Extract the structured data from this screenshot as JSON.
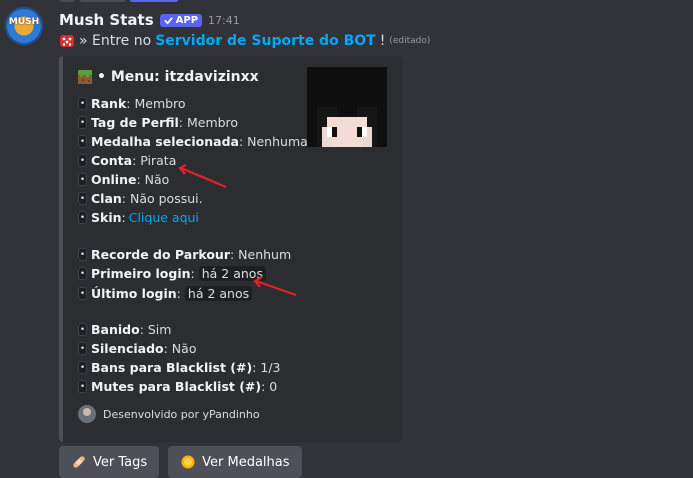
{
  "bot": {
    "name": "Mush Stats",
    "badge": "APP",
    "time": "17:41",
    "avatar_text": "MUSH"
  },
  "message": {
    "prefix": "» Entre no ",
    "link": "Servidor de Suporte do BOT",
    "suffix": "!",
    "edited": "(editado)"
  },
  "embed": {
    "title": "• Menu: itzdavizinxx",
    "bullet": "•",
    "fields": [
      {
        "key": "Rank",
        "value": ": Membro"
      },
      {
        "key": "Tag de Perfil",
        "value": ": Membro"
      },
      {
        "key": "Medalha selecionada",
        "value": ": Nenhuma"
      },
      {
        "key": "Conta",
        "value": ": Pirata"
      },
      {
        "key": "Online",
        "value": ": Não"
      },
      {
        "key": "Clan",
        "value": ": Não possui."
      },
      {
        "key": "Skin",
        "value": ":",
        "link": "Clique aqui"
      },
      {
        "key": "Recorde do Parkour",
        "value": ": Nenhum"
      },
      {
        "key": "Primeiro login",
        "value": ":",
        "code": "há 2 anos"
      },
      {
        "key": "Último login",
        "value": ":",
        "code": "há 2 anos"
      },
      {
        "key": "Banido",
        "value": ": Sim"
      },
      {
        "key": "Silenciado",
        "value": ": Não"
      },
      {
        "key": "Bans para Blacklist (#)",
        "value": ": 1/3"
      },
      {
        "key": "Mutes para Blacklist (#)",
        "value": ": 0"
      }
    ],
    "footer": "Desenvolvido por yPandinho"
  },
  "buttons": [
    {
      "label": "Ver Tags",
      "icon": "bandage-icon"
    },
    {
      "label": "Ver Medalhas",
      "icon": "medal-icon"
    }
  ],
  "colors": {
    "link": "#00a8fc",
    "badge": "#5865f2",
    "arrow": "#e02424"
  }
}
